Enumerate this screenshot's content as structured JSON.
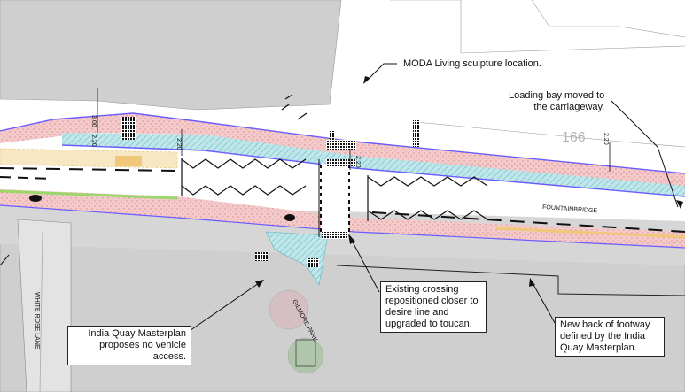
{
  "annotations": {
    "moda": "MODA Living sculpture location.",
    "loading_bay": "Loading bay moved to\nthe carriageway.",
    "crossing": "Existing crossing\nrepositioned closer to\ndesire line and\nupgraded to toucan.",
    "india_quay": "India Quay Masterplan\nproposes no vehicle\naccess.",
    "footway": "New  back of footway\ndefined by the India\nQuay Masterplan."
  },
  "labels": {
    "street": "FOUNTAINBRIDGE",
    "lane": "WHITE ROSE LANE",
    "park": "GILMORE PARK",
    "building_number": "166"
  },
  "dimensions": {
    "d1": "3.00",
    "d2": "2.20",
    "d3": "2.20",
    "d4": "2.20",
    "d5": "2.20"
  },
  "colors": {
    "footway": "#f3c9c9",
    "cycle_lane": "#bfe6ea",
    "outline": "#6a5cff",
    "verge": "#9bd86a",
    "parking": "#f5d99a",
    "ground": "#cfcfcf"
  }
}
